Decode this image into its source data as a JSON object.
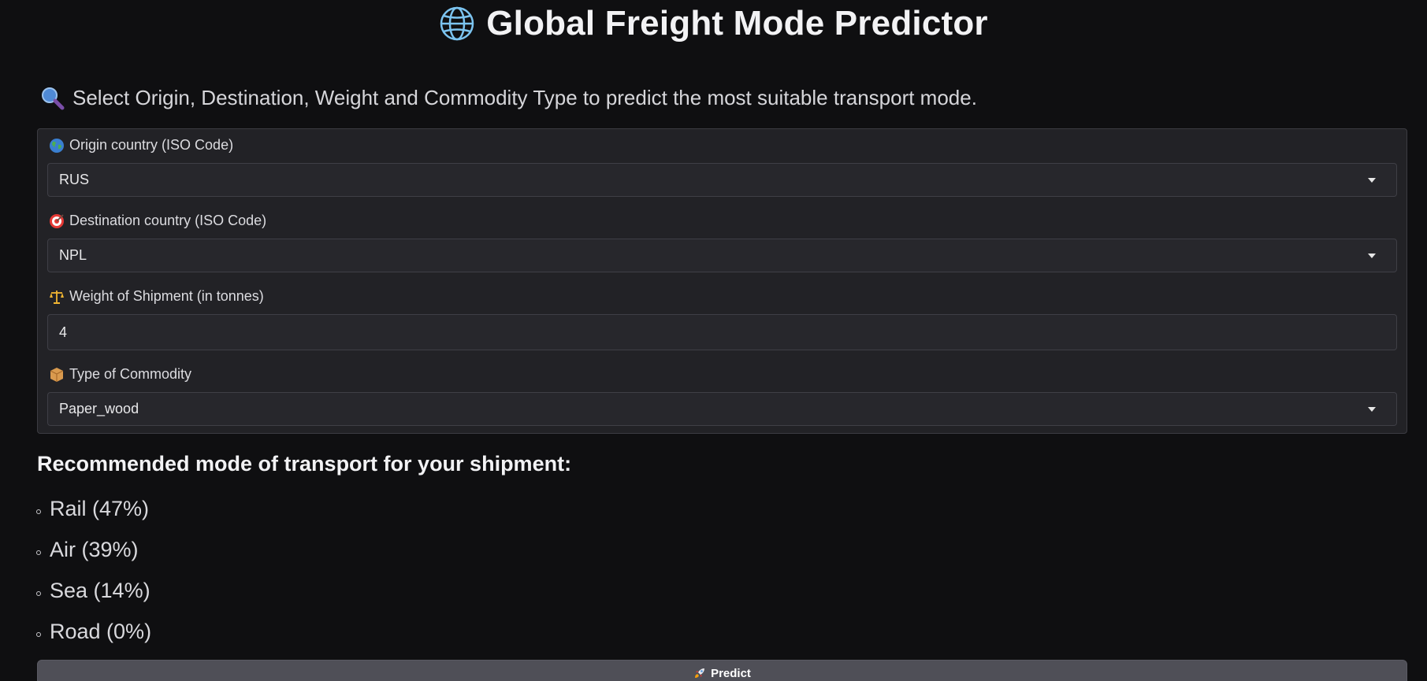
{
  "header": {
    "title": "Global Freight Mode Predictor",
    "title_icon": "globe-icon"
  },
  "intro": {
    "text": "Select Origin, Destination, Weight and Commodity Type to predict the most suitable transport mode.",
    "icon": "magnifying-glass-icon"
  },
  "form": {
    "origin": {
      "label": "Origin country (ISO Code)",
      "icon": "earth-globe-icon",
      "value": "RUS"
    },
    "destination": {
      "label": "Destination country (ISO Code)",
      "icon": "target-icon",
      "value": "NPL"
    },
    "weight": {
      "label": "Weight of Shipment (in tonnes)",
      "icon": "scales-icon",
      "value": "4"
    },
    "commodity": {
      "label": "Type of Commodity",
      "icon": "package-icon",
      "value": "Paper_wood"
    }
  },
  "recommendation": {
    "heading": "Recommended mode of transport for your shipment:",
    "items": [
      {
        "label": "Rail (47%)"
      },
      {
        "label": "Air (39%)"
      },
      {
        "label": "Sea (14%)"
      },
      {
        "label": "Road (0%)"
      }
    ]
  },
  "actions": {
    "predict_label": "Predict",
    "predict_icon": "rocket-icon"
  },
  "colors": {
    "background": "#0f0f11",
    "panel": "#222226",
    "input": "#27272c",
    "button": "#4f4f57"
  }
}
